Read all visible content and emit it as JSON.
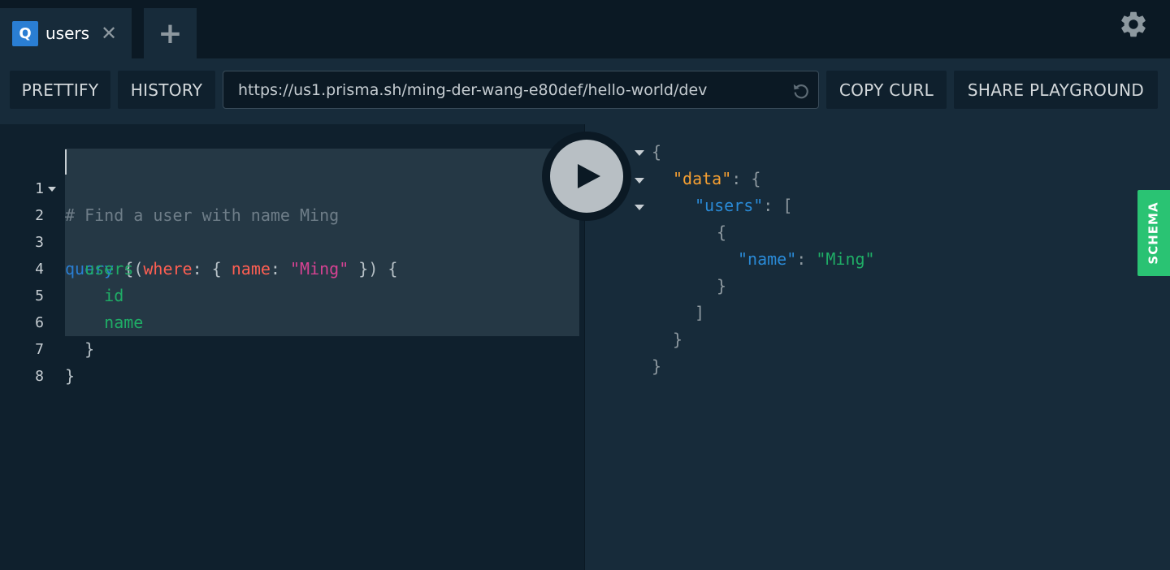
{
  "tabs": [
    {
      "badge": "Q",
      "title": "users",
      "close": "✕"
    }
  ],
  "new_tab_label": "+",
  "toolbar": {
    "prettify": "PRETTIFY",
    "history": "HISTORY",
    "endpoint_url": "https://us1.prisma.sh/ming-der-wang-e80def/hello-world/dev",
    "copy_curl": "COPY CURL",
    "share_playground": "SHARE PLAYGROUND"
  },
  "editor": {
    "line_numbers": [
      "1",
      "2",
      "3",
      "4",
      "5",
      "6",
      "7",
      "8"
    ],
    "lines": {
      "l1": {
        "comment": "# Find a user with name Ming"
      },
      "l2": {
        "keyword": "query",
        "brace": " {"
      },
      "l3": {
        "indent": "  ",
        "field": "users",
        "open": "(",
        "arg1": "where",
        "sep1": ": { ",
        "arg2": "name",
        "sep2": ": ",
        "value": "\"Ming\"",
        "close": " }) {"
      },
      "l4": {
        "indent": "    ",
        "field": "id"
      },
      "l5": {
        "indent": "    ",
        "field": "name"
      },
      "l6": {
        "text": "  }"
      },
      "l7": {
        "text": "}"
      }
    }
  },
  "result": {
    "r1": "{",
    "r2": {
      "key": "\"data\"",
      "tail": ": {"
    },
    "r3": {
      "key": "\"users\"",
      "tail": ": ["
    },
    "r4": "{",
    "r5": {
      "key": "\"name\"",
      "sep": ": ",
      "value": "\"Ming\""
    },
    "r6": "}",
    "r7": "]",
    "r8": "}",
    "r9": "}"
  },
  "schema_tab": "SCHEMA",
  "colors": {
    "accent_blue": "#2a7ed3",
    "schema_green": "#2ac373",
    "json_data_orange": "#f7a032"
  },
  "icons": {
    "settings": "gear-icon",
    "reload": "reload-icon",
    "execute": "play-icon",
    "close": "close-icon",
    "new_tab": "plus-icon"
  }
}
